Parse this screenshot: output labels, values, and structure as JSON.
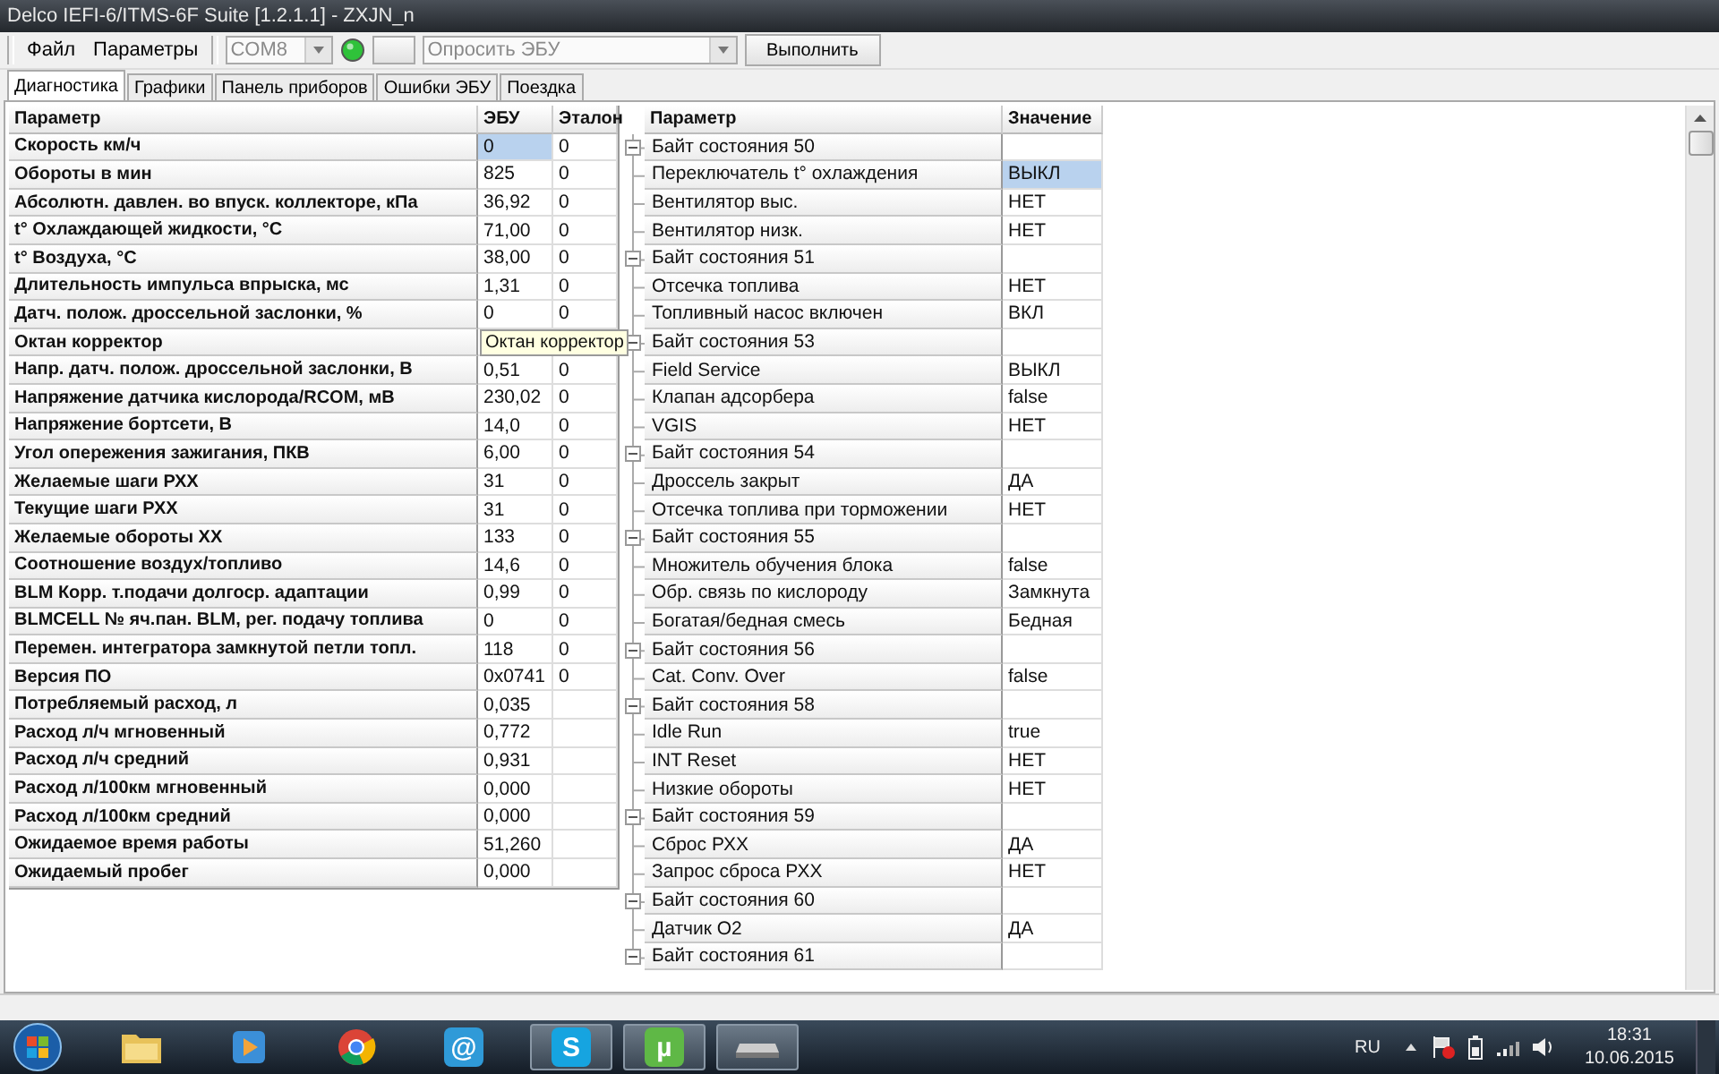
{
  "window": {
    "title": "Delco IEFI-6/ITMS-6F Suite [1.2.1.1] - ZXJN_n"
  },
  "menu": [
    "Файл",
    "Параметры"
  ],
  "toolbar": {
    "port": {
      "value": "COM8",
      "disabled": true
    },
    "connected": true,
    "request": {
      "value": "Опросить ЭБУ",
      "disabled": true
    },
    "run_button": "Выполнить"
  },
  "tabs": [
    {
      "label": "Диагностика",
      "selected": true
    },
    {
      "label": "Графики",
      "selected": false
    },
    {
      "label": "Панель приборов",
      "selected": false
    },
    {
      "label": "Ошибки ЭБУ",
      "selected": false
    },
    {
      "label": "Поездка",
      "selected": false
    }
  ],
  "params_table": {
    "columns": [
      "Параметр",
      "ЭБУ",
      "Эталон"
    ],
    "rows": [
      {
        "param": "Скорость км/ч",
        "ecu": "0",
        "ref": "0",
        "selected": true
      },
      {
        "param": "Обороты в мин",
        "ecu": "825",
        "ref": "0",
        "selected": false
      },
      {
        "param": "Абсолютн. давлен. во впуск. коллекторе, кПа",
        "ecu": "36,92",
        "ref": "0",
        "selected": false
      },
      {
        "param": "t° Охлаждающей жидкости, °C",
        "ecu": "71,00",
        "ref": "0",
        "selected": false
      },
      {
        "param": "t° Воздуха, °C",
        "ecu": "38,00",
        "ref": "0",
        "selected": false
      },
      {
        "param": "Длительность импульса впрыска, мс",
        "ecu": "1,31",
        "ref": "0",
        "selected": false
      },
      {
        "param": "Датч. полож. дроссельной заслонки, %",
        "ecu": "0",
        "ref": "0",
        "selected": false
      },
      {
        "param": "Октан корректор",
        "tooltip": "Октан корректор",
        "selected": false
      },
      {
        "param": "Напр. датч. полож. дроссельной заслонки, В",
        "ecu": "0,51",
        "ref": "0",
        "selected": false
      },
      {
        "param": "Напряжение датчика кислорода/RCOM, мВ",
        "ecu": "230,02",
        "ref": "0",
        "selected": false
      },
      {
        "param": "Напряжение бортсети, В",
        "ecu": "14,0",
        "ref": "0",
        "selected": false
      },
      {
        "param": "Угол опережения зажигания, ПКВ",
        "ecu": "6,00",
        "ref": "0",
        "selected": false
      },
      {
        "param": "Желаемые шаги РХХ",
        "ecu": "31",
        "ref": "0",
        "selected": false
      },
      {
        "param": "Текущие шаги РХХ",
        "ecu": "31",
        "ref": "0",
        "selected": false
      },
      {
        "param": "Желаемые обороты ХХ",
        "ecu": "133",
        "ref": "0",
        "selected": false
      },
      {
        "param": "Соотношение воздух/топливо",
        "ecu": "14,6",
        "ref": "0",
        "selected": false
      },
      {
        "param": "BLM Корр. т.подачи долгоср. адаптации",
        "ecu": "0,99",
        "ref": "0",
        "selected": false
      },
      {
        "param": "BLMCELL № яч.пан. BLM, рег. подачу топлива",
        "ecu": "0",
        "ref": "0",
        "selected": false
      },
      {
        "param": "Перемен. интегратора замкнутой петли топл.",
        "ecu": "118",
        "ref": "0",
        "selected": false
      },
      {
        "param": "Версия ПО",
        "ecu": "0x0741",
        "ref": "0",
        "selected": false
      },
      {
        "param": "Потребляемый расход, л",
        "ecu": "0,035",
        "selected": false
      },
      {
        "param": "Расход л/ч мгновенный",
        "ecu": "0,772",
        "selected": false
      },
      {
        "param": "Расход л/ч средний",
        "ecu": "0,931",
        "selected": false
      },
      {
        "param": "Расход л/100км мгновенный",
        "ecu": "0,000",
        "selected": false
      },
      {
        "param": "Расход л/100км средний",
        "ecu": "0,000",
        "selected": false
      },
      {
        "param": "Ожидаемое время работы",
        "ecu": "51,260",
        "selected": false
      },
      {
        "param": "Ожидаемый пробег",
        "ecu": "0,000",
        "selected": false
      }
    ]
  },
  "status_tree": {
    "columns": [
      "Параметр",
      "Значение"
    ],
    "groups": [
      {
        "label": "Байт состояния 50",
        "expanded": true,
        "children": [
          {
            "param": "Переключатель t° охлаждения",
            "value": "ВЫКЛ",
            "selected": true
          },
          {
            "param": "Вентилятор выс.",
            "value": "НЕТ",
            "selected": false
          },
          {
            "param": "Вентилятор низк.",
            "value": "НЕТ",
            "selected": false
          }
        ]
      },
      {
        "label": "Байт состояния 51",
        "expanded": true,
        "children": [
          {
            "param": "Отсечка топлива",
            "value": "НЕТ",
            "selected": false
          },
          {
            "param": "Топливный насос включен",
            "value": "ВКЛ",
            "selected": false
          }
        ]
      },
      {
        "label": "Байт состояния 53",
        "expanded": true,
        "children": [
          {
            "param": "Field Service",
            "value": "ВЫКЛ",
            "selected": false
          },
          {
            "param": "Клапан адсорбера",
            "value": "false",
            "selected": false
          },
          {
            "param": "VGIS",
            "value": "НЕТ",
            "selected": false
          }
        ]
      },
      {
        "label": "Байт состояния 54",
        "expanded": true,
        "children": [
          {
            "param": "Дроссель закрыт",
            "value": "ДА",
            "selected": false
          },
          {
            "param": "Отсечка топлива при торможении",
            "value": "НЕТ",
            "selected": false
          }
        ]
      },
      {
        "label": "Байт состояния 55",
        "expanded": true,
        "children": [
          {
            "param": "Множитель обучения блока",
            "value": "false",
            "selected": false
          },
          {
            "param": "Обр. связь по кислороду",
            "value": "Замкнута",
            "selected": false
          },
          {
            "param": "Богатая/бедная смесь",
            "value": "Бедная",
            "selected": false
          }
        ]
      },
      {
        "label": "Байт состояния 56",
        "expanded": true,
        "children": [
          {
            "param": "Cat. Conv. Over",
            "value": "false",
            "selected": false
          }
        ]
      },
      {
        "label": "Байт состояния 58",
        "expanded": true,
        "children": [
          {
            "param": "Idle Run",
            "value": "true",
            "selected": false
          },
          {
            "param": "INT Reset",
            "value": "НЕТ",
            "selected": false
          },
          {
            "param": "Низкие обороты",
            "value": "НЕТ",
            "selected": false
          }
        ]
      },
      {
        "label": "Байт состояния 59",
        "expanded": true,
        "children": [
          {
            "param": "Сброс РХХ",
            "value": "ДА",
            "selected": false
          },
          {
            "param": "Запрос сброса РХХ",
            "value": "НЕТ",
            "selected": false
          }
        ]
      },
      {
        "label": "Байт состояния 60",
        "expanded": true,
        "children": [
          {
            "param": "Датчик O2",
            "value": "ДА",
            "selected": false
          }
        ]
      },
      {
        "label": "Байт состояния 61",
        "expanded": true
      }
    ]
  },
  "taskbar": {
    "items": [
      {
        "kind": "folder",
        "active": false
      },
      {
        "kind": "media",
        "active": false
      },
      {
        "kind": "chrome",
        "active": false
      },
      {
        "kind": "mail",
        "glyph": "@",
        "active": false
      },
      {
        "kind": "skype",
        "glyph": "S",
        "active": true
      },
      {
        "kind": "torrent",
        "glyph": "µ",
        "active": true
      },
      {
        "kind": "drive",
        "active": true
      }
    ],
    "language": "RU",
    "time": "18:31",
    "date": "10.06.2015"
  }
}
